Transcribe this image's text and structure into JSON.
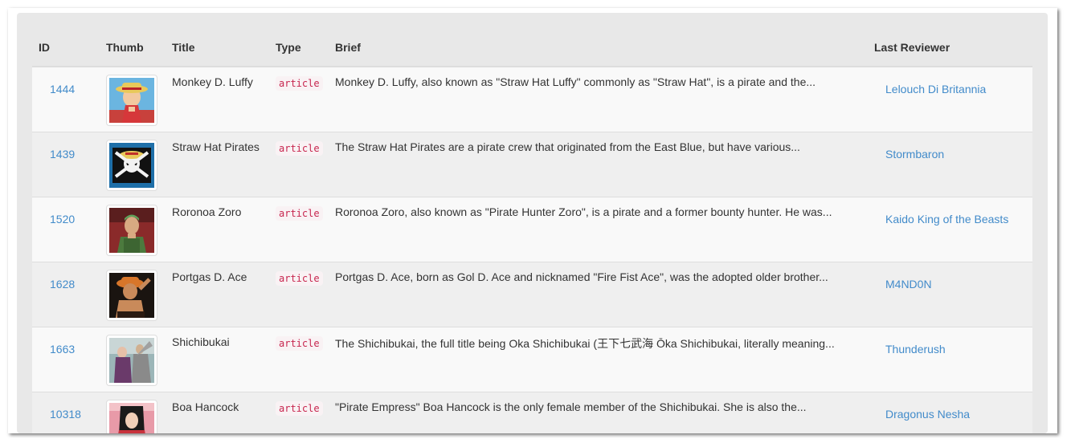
{
  "table": {
    "headers": {
      "id": "ID",
      "thumb": "Thumb",
      "title": "Title",
      "type": "Type",
      "brief": "Brief",
      "reviewer": "Last Reviewer"
    },
    "rows": [
      {
        "id": "1444",
        "title": "Monkey D. Luffy",
        "type": "article",
        "brief": "Monkey D. Luffy, also known as \"Straw Hat Luffy\" commonly as \"Straw Hat\", is a pirate and the...",
        "reviewer": "Lelouch Di Britannia",
        "thumb_icon": "luffy-thumbnail"
      },
      {
        "id": "1439",
        "title": "Straw Hat Pirates",
        "type": "article",
        "brief": "The Straw Hat Pirates are a pirate crew that originated from the East Blue, but have various...",
        "reviewer": "Stormbaron",
        "thumb_icon": "jolly-roger-thumbnail"
      },
      {
        "id": "1520",
        "title": "Roronoa Zoro",
        "type": "article",
        "brief": "Roronoa Zoro, also known as \"Pirate Hunter Zoro\", is a pirate and a former bounty hunter. He was...",
        "reviewer": "Kaido King of the Beasts",
        "thumb_icon": "zoro-thumbnail"
      },
      {
        "id": "1628",
        "title": "Portgas D. Ace",
        "type": "article",
        "brief": "Portgas D. Ace, born as Gol D. Ace and nicknamed \"Fire Fist Ace\", was the adopted older brother...",
        "reviewer": "M4ND0N",
        "thumb_icon": "ace-thumbnail"
      },
      {
        "id": "1663",
        "title": "Shichibukai",
        "type": "article",
        "brief": "The Shichibukai, the full title being Oka Shichibukai (王下七武海 Ōka Shichibukai, literally meaning...",
        "reviewer": "Thunderush",
        "thumb_icon": "shichibukai-thumbnail"
      },
      {
        "id": "10318",
        "title": "Boa Hancock",
        "type": "article",
        "brief": "\"Pirate Empress\" Boa Hancock is the only female member of the Shichibukai. She is also the...",
        "reviewer": "Dragonus Nesha",
        "thumb_icon": "hancock-thumbnail"
      }
    ]
  },
  "colors": {
    "link": "#428bca",
    "code_text": "#c7254e",
    "code_bg": "#f9f2f4",
    "panel_bg": "#e8e8e8"
  }
}
